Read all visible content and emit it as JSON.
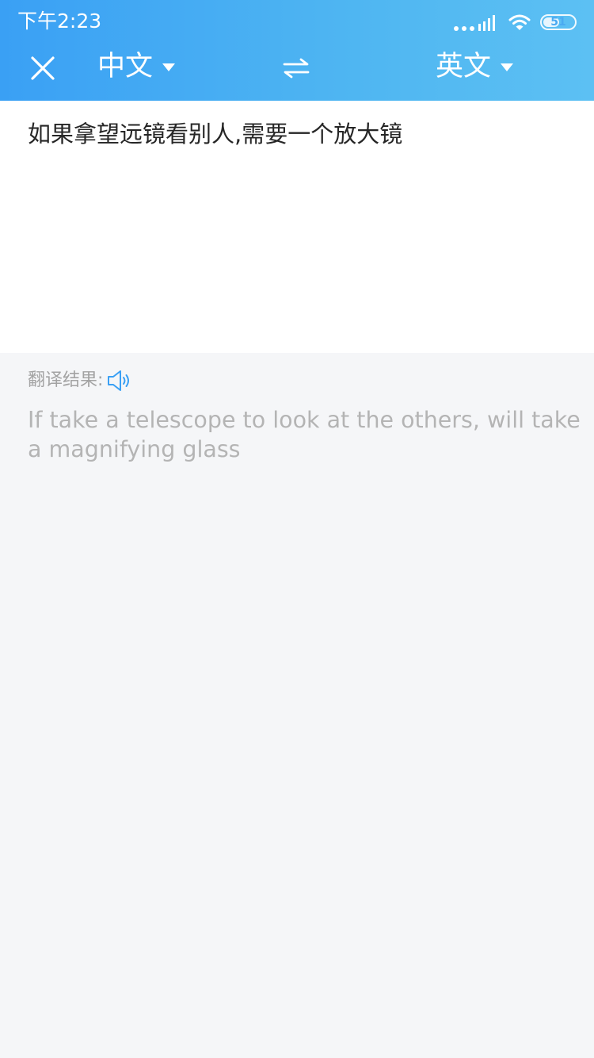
{
  "status_bar": {
    "time": "下午2:23",
    "battery_level": "51",
    "icons": [
      "signal-icon",
      "wifi-icon",
      "battery-icon"
    ]
  },
  "nav": {
    "close_icon": "close-icon",
    "swap_icon": "swap-arrows-icon",
    "source_language": "中文",
    "target_language": "英文"
  },
  "source": {
    "text": "如果拿望远镜看别人,需要一个放大镜"
  },
  "result": {
    "label": "翻译结果:",
    "speaker_icon": "speaker-icon",
    "text": "If take a telescope to look at the others, will take a magnifying glass"
  },
  "colors": {
    "header_start": "#3aa0f4",
    "header_end": "#5cc0f3",
    "source_bg": "#ffffff",
    "result_bg": "#f5f6f8",
    "source_text": "#262626",
    "result_text": "#b4b4b4",
    "speaker_accent": "#3aa0f4"
  }
}
